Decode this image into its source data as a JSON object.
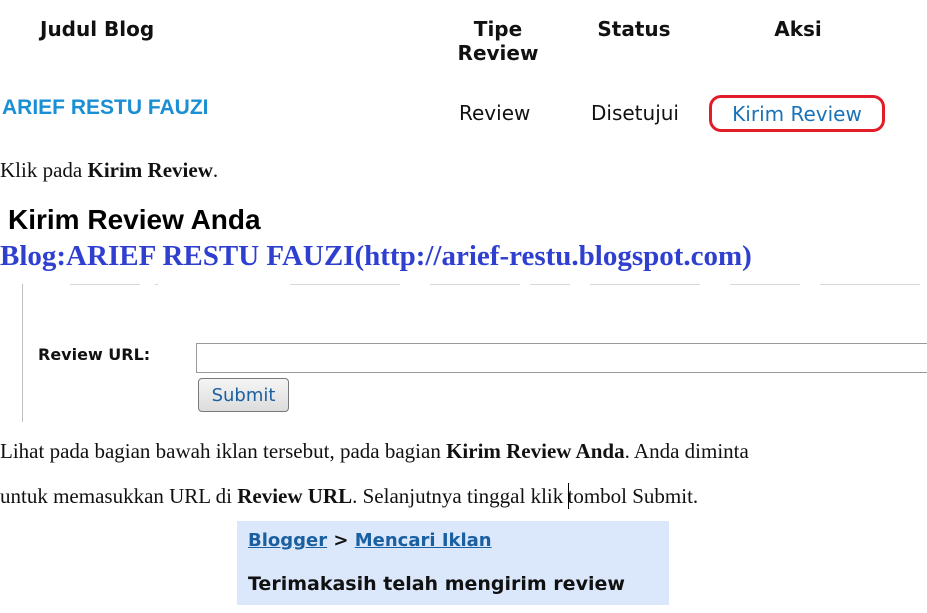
{
  "table": {
    "headers": {
      "judul": "Judul Blog",
      "tipe_line1": "Tipe",
      "tipe_line2": "Review",
      "status": "Status",
      "aksi": "Aksi"
    },
    "row": {
      "blog": "ARIEF RESTU FAUZI",
      "tipe": "Review",
      "status": "Disetujui",
      "aksi": "Kirim Review"
    }
  },
  "instructions": {
    "p1_prefix": "Klik pada ",
    "p1_bold": "Kirim Review",
    "p1_suffix": ".",
    "p2_prefix": "Lihat pada bagian bawah iklan tersebut, pada bagian ",
    "p2_bold": "Kirim Review Anda",
    "p2_suffix": ". Anda diminta",
    "p3_prefix": "untuk memasukkan URL di ",
    "p3_bold": "Review URL",
    "p3_mid_a": ". Selanjutnya tinggal klik ",
    "p3_mid_b": "tombol Submit."
  },
  "form": {
    "title": "Kirim Review Anda",
    "url_label": "Review URL:",
    "url_value": "",
    "submit_label": "Submit"
  },
  "watermark": "Blog:ARIEF RESTU FAUZI(http://arief-restu.blogspot.com)",
  "confirmation": {
    "crumb_1": "Blogger",
    "crumb_sep": " > ",
    "crumb_2": "Mencari Iklan",
    "message": "Terimakasih telah mengirim review"
  },
  "colors": {
    "link": "#1a73b8",
    "highlight_ring": "#e11d2a",
    "blog_name": "#1a8fd3",
    "watermark": "#2f3fcf",
    "confirm_bg": "#dbe7fb"
  }
}
